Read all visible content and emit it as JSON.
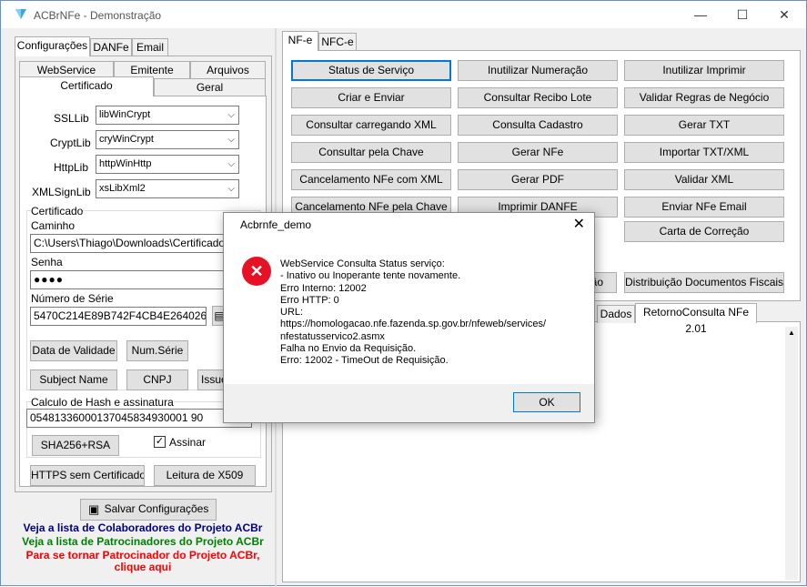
{
  "window": {
    "title": "ACBrNFe - Demonstração",
    "minimize": "—",
    "maximize": "☐",
    "close": "✕"
  },
  "left_tabs": [
    "Configurações",
    "DANFe",
    "Email"
  ],
  "config_tabs_row1": [
    "WebService",
    "Emitente",
    "Arquivos"
  ],
  "config_tabs_row2": [
    "Certificado",
    "Geral"
  ],
  "libs": [
    {
      "label": "SSLLib",
      "value": "libWinCrypt"
    },
    {
      "label": "CryptLib",
      "value": "cryWinCrypt"
    },
    {
      "label": "HttpLib",
      "value": "httpWinHttp"
    },
    {
      "label": "XMLSignLib",
      "value": "xsLibXml2"
    }
  ],
  "cert": {
    "group_title": "Certificado",
    "caminho_label": "Caminho",
    "caminho_value": "C:\\Users\\Thiago\\Downloads\\Certificado A1",
    "senha_label": "Senha",
    "senha_value": "●●●●",
    "serie_label": "Número de Série",
    "serie_value": "5470C214E89B742F4CB4E26402624E"
  },
  "cert_buttons": [
    "Data de Validade",
    "Num.Série",
    "Subject Name",
    "CNPJ",
    "Issuer"
  ],
  "hash": {
    "group_title": "Calculo de Hash e assinatura",
    "value": "05481336000137045834930001 90",
    "button": "SHA256+RSA",
    "check_label": "Assinar",
    "check_mark": "✓"
  },
  "bottom_buttons": [
    "HTTPS sem Certificado",
    "Leitura de X509"
  ],
  "save_button": "Salvar Configurações",
  "links": [
    {
      "text": "Veja a lista de Colaboradores do Projeto ACBr",
      "color": "#000080"
    },
    {
      "text": "Veja a lista de Patrocinadores do Projeto ACBr",
      "color": "#008000"
    },
    {
      "text": "Para se tornar Patrocinador do Projeto ACBr,",
      "color": "#ff0000"
    },
    {
      "text": "clique aqui",
      "color": "#ff0000"
    }
  ],
  "right_tabs": [
    "NF-e",
    "NFC-e"
  ],
  "action_buttons": [
    [
      "Status de Serviço",
      "Inutilizar Numeração",
      "Inutilizar Imprimir"
    ],
    [
      "Criar e Enviar",
      "Consultar Recibo Lote",
      "Validar Regras de Negócio"
    ],
    [
      "Consultar carregando XML",
      "Consulta Cadastro",
      "Gerar TXT"
    ],
    [
      "Consultar pela Chave",
      "Gerar NFe",
      "Importar TXT/XML"
    ],
    [
      "Cancelamento NFe com XML",
      "Gerar PDF",
      "Validar XML"
    ],
    [
      "Cancelamento NFe pela Chave",
      "Imprimir DANFE",
      "Enviar NFe Email"
    ],
    [
      "",
      "",
      "Carta de Correção"
    ],
    [
      "",
      "ão",
      "Distribuição Documentos Fiscais"
    ]
  ],
  "bottom_tabs": [
    "Dados",
    "RetornoConsulta NFe 2.01"
  ],
  "dialog": {
    "title": "Acbrnfe_demo",
    "close": "✕",
    "icon_mark": "✕",
    "lines": [
      "WebService Consulta Status serviço:",
      "- Inativo ou Inoperante tente novamente.",
      "Erro Interno: 12002",
      "Erro HTTP: 0",
      "URL:",
      "https://homologacao.nfe.fazenda.sp.gov.br/nfeweb/services/",
      "nfestatusservico2.asmx",
      "Falha no Envio da Requisição.",
      "Erro: 12002 - TimeOut de Requisição."
    ],
    "ok": "OK"
  }
}
